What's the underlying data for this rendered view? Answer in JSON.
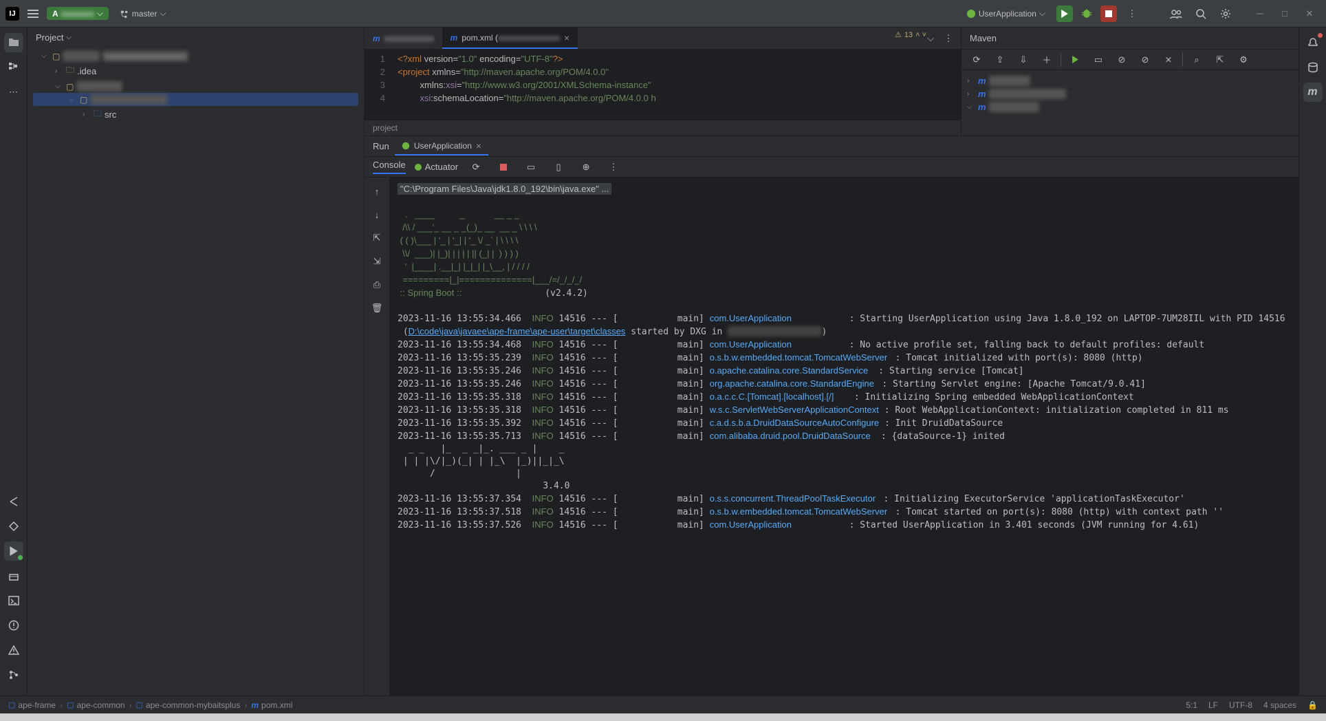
{
  "titlebar": {
    "project_name_hidden": "xxxxxxxx",
    "branch_name": "master",
    "run_config": "UserApplication"
  },
  "project_panel": {
    "title": "Project",
    "root_hidden": "xxxxxxx",
    "root_path_hidden": "xxxxxxxxxxxxxxxxxx",
    "idea_folder": ".idea",
    "module1_hidden": "xxxxxxxxx",
    "module2_hidden": "xxxxxxxxxxxxxxxx",
    "src_folder": "src"
  },
  "editor": {
    "tab1_name_hidden": "xxxxxxxxxxxx",
    "tab2_prefix": "pom.xml (",
    "tab2_suffix_hidden": "xxxxxxxxxxxxxxx",
    "warn_count": "13",
    "line1": "<?xml version=\"1.0\" encoding=\"UTF-8\"?>",
    "line2_a": "<project ",
    "line2_b": "xmlns",
    "line2_c": "=\"http://maven.apache.org/POM/4.0.0\"",
    "line3_a": "         xmlns:",
    "line3_b": "xsi",
    "line3_c": "=\"http://www.w3.org/2001/XMLSchema-instance\"",
    "line4_a": "         ",
    "line4_b": "xsi",
    "line4_c": ":schemaLocation",
    "line4_d": "=\"http://maven.apache.org/POM/4.0.0 h",
    "footer_path": "project"
  },
  "maven": {
    "title": "Maven",
    "item1_hidden": "xxxxxxxx",
    "item2_hidden": "xxxxxxxxxxxxxxxx",
    "item3_hidden": "xxxxxxxxxx"
  },
  "run": {
    "title": "Run",
    "tab_name": "UserApplication",
    "console_tab": "Console",
    "actuator_tab": "Actuator",
    "cmd": "\"C:\\Program Files\\Java\\jdk1.8.0_192\\bin\\java.exe\" ...",
    "banner": "   .   ____          _            __ _ _\n  /\\\\ / ___'_ __ _ _(_)_ __  __ _ \\ \\ \\ \\\n ( ( )\\___ | '_ | '_| | '_ \\/ _` | \\ \\ \\ \\\n  \\\\/  ___)| |_)| | | | | || (_| |  ) ) ) )\n   '  |____| .__|_| |_|_| |_\\__, | / / / /\n  =========|_|==============|___/=/_/_/_/",
    "boot_line": " :: Spring Boot :: ",
    "boot_ver": "(v2.4.2)",
    "mybatis_banner": "  _ _   |_  _ _|_. ___ _ |    _\n | | |\\/|_)(_| | |_\\  |_)||_|_\\\n      /               |\n                           3.4.0",
    "logs": [
      {
        "ts": "2023-11-16 13:55:34.466",
        "lvl": "INFO",
        "pid": "14516",
        "th": "main",
        "cls": "com.UserApplication",
        "msg": ": Starting UserApplication using Java 1.8.0_192 on LAPTOP-7UM28IIL with PID 14516"
      },
      {
        "ts": "2023-11-16 13:55:34.468",
        "lvl": "INFO",
        "pid": "14516",
        "th": "main",
        "cls": "com.UserApplication",
        "msg": ": No active profile set, falling back to default profiles: default"
      },
      {
        "ts": "2023-11-16 13:55:35.239",
        "lvl": "INFO",
        "pid": "14516",
        "th": "main",
        "cls": "o.s.b.w.embedded.tomcat.TomcatWebServer",
        "msg": ": Tomcat initialized with port(s): 8080 (http)"
      },
      {
        "ts": "2023-11-16 13:55:35.246",
        "lvl": "INFO",
        "pid": "14516",
        "th": "main",
        "cls": "o.apache.catalina.core.StandardService",
        "msg": ": Starting service [Tomcat]"
      },
      {
        "ts": "2023-11-16 13:55:35.246",
        "lvl": "INFO",
        "pid": "14516",
        "th": "main",
        "cls": "org.apache.catalina.core.StandardEngine",
        "msg": ": Starting Servlet engine: [Apache Tomcat/9.0.41]"
      },
      {
        "ts": "2023-11-16 13:55:35.318",
        "lvl": "INFO",
        "pid": "14516",
        "th": "main",
        "cls": "o.a.c.c.C.[Tomcat].[localhost].[/]",
        "msg": ": Initializing Spring embedded WebApplicationContext"
      },
      {
        "ts": "2023-11-16 13:55:35.318",
        "lvl": "INFO",
        "pid": "14516",
        "th": "main",
        "cls": "w.s.c.ServletWebServerApplicationContext",
        "msg": ": Root WebApplicationContext: initialization completed in 811 ms"
      },
      {
        "ts": "2023-11-16 13:55:35.392",
        "lvl": "INFO",
        "pid": "14516",
        "th": "main",
        "cls": "c.a.d.s.b.a.DruidDataSourceAutoConfigure",
        "msg": ": Init DruidDataSource"
      },
      {
        "ts": "2023-11-16 13:55:35.713",
        "lvl": "INFO",
        "pid": "14516",
        "th": "main",
        "cls": "com.alibaba.druid.pool.DruidDataSource",
        "msg": ": {dataSource-1} inited"
      },
      {
        "ts": "2023-11-16 13:55:37.354",
        "lvl": "INFO",
        "pid": "14516",
        "th": "main",
        "cls": "o.s.s.concurrent.ThreadPoolTaskExecutor",
        "msg": ": Initializing ExecutorService 'applicationTaskExecutor'"
      },
      {
        "ts": "2023-11-16 13:55:37.518",
        "lvl": "INFO",
        "pid": "14516",
        "th": "main",
        "cls": "o.s.b.w.embedded.tomcat.TomcatWebServer",
        "msg": ": Tomcat started on port(s): 8080 (http) with context path ''"
      },
      {
        "ts": "2023-11-16 13:55:37.526",
        "lvl": "INFO",
        "pid": "14516",
        "th": "main",
        "cls": "com.UserApplication",
        "msg": ": Started UserApplication in 3.401 seconds (JVM running for 4.61)"
      }
    ],
    "classes_link": "D:\\code\\java\\javaee\\ape-frame\\ape-user\\target\\classes",
    "started_by": " started by DXG in ",
    "path_blur": "xxxxxxxxxxxxxxxxxxxxx"
  },
  "breadcrumbs": {
    "c1": "ape-frame",
    "c2": "ape-common",
    "c3": "ape-common-mybaitsplus",
    "c4": "pom.xml"
  },
  "status": {
    "pos": "5:1",
    "sep": "LF",
    "enc": "UTF-8",
    "indent": "4 spaces"
  }
}
